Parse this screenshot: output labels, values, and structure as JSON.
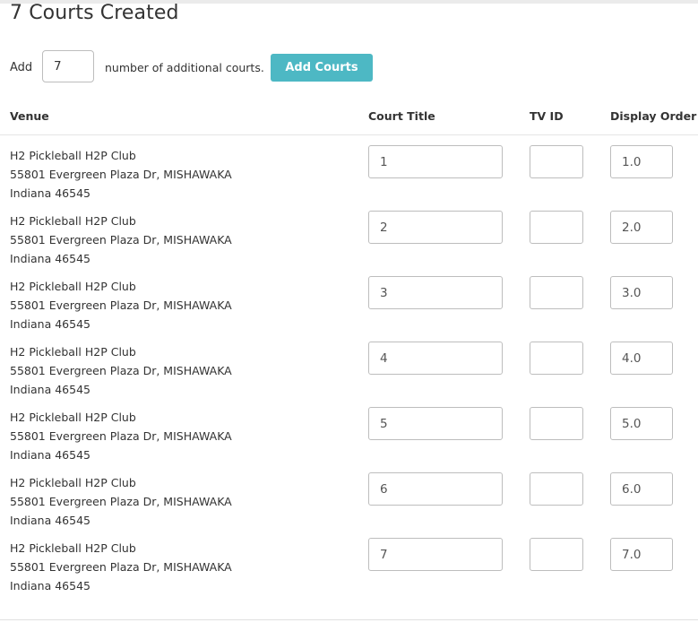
{
  "page": {
    "title": "7 Courts Created"
  },
  "add_courts": {
    "prefix_label": "Add",
    "count_value": "7",
    "suffix_label": "number of additional courts.",
    "button_label": "Add Courts",
    "button_color": "#4db8c4"
  },
  "table": {
    "columns": [
      "Venue",
      "Court Title",
      "TV ID",
      "Display Order"
    ],
    "rows": [
      {
        "venue_name": "H2 Pickleball H2P Club",
        "venue_address": "55801 Evergreen Plaza Dr, MISHAWAKA",
        "venue_state": "Indiana 46545",
        "court_title": "1",
        "tv_id": "",
        "display_order": "1.0"
      },
      {
        "venue_name": "H2 Pickleball H2P Club",
        "venue_address": "55801 Evergreen Plaza Dr, MISHAWAKA",
        "venue_state": "Indiana 46545",
        "court_title": "2",
        "tv_id": "",
        "display_order": "2.0"
      },
      {
        "venue_name": "H2 Pickleball H2P Club",
        "venue_address": "55801 Evergreen Plaza Dr, MISHAWAKA",
        "venue_state": "Indiana 46545",
        "court_title": "3",
        "tv_id": "",
        "display_order": "3.0"
      },
      {
        "venue_name": "H2 Pickleball H2P Club",
        "venue_address": "55801 Evergreen Plaza Dr, MISHAWAKA",
        "venue_state": "Indiana 46545",
        "court_title": "4",
        "tv_id": "",
        "display_order": "4.0"
      },
      {
        "venue_name": "H2 Pickleball H2P Club",
        "venue_address": "55801 Evergreen Plaza Dr, MISHAWAKA",
        "venue_state": "Indiana 46545",
        "court_title": "5",
        "tv_id": "",
        "display_order": "5.0"
      },
      {
        "venue_name": "H2 Pickleball H2P Club",
        "venue_address": "55801 Evergreen Plaza Dr, MISHAWAKA",
        "venue_state": "Indiana 46545",
        "court_title": "6",
        "tv_id": "",
        "display_order": "6.0"
      },
      {
        "venue_name": "H2 Pickleball H2P Club",
        "venue_address": "55801 Evergreen Plaza Dr, MISHAWAKA",
        "venue_state": "Indiana 46545",
        "court_title": "7",
        "tv_id": "",
        "display_order": "7.0"
      }
    ]
  }
}
